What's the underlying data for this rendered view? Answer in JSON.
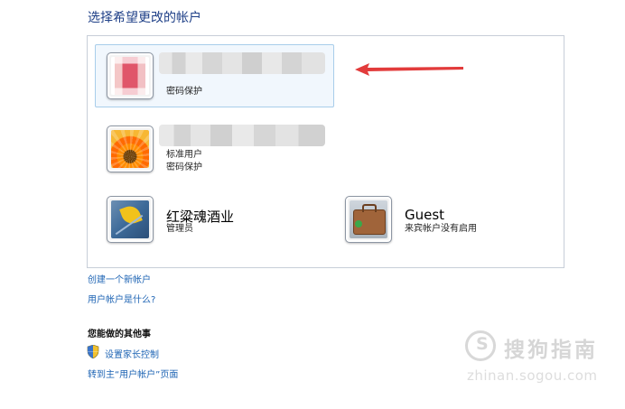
{
  "page": {
    "title": "选择希望更改的帐户"
  },
  "accounts": [
    {
      "name": "",
      "type": "",
      "password": "密码保护",
      "selected": true,
      "avatar": "blurred-avatar"
    },
    {
      "name": "",
      "type": "标准用户",
      "password": "密码保护",
      "selected": false,
      "avatar": "flower-avatar"
    },
    {
      "name": "红粱魂酒业",
      "type": "管理员",
      "password": "",
      "selected": false,
      "avatar": "leaf-avatar"
    },
    {
      "name": "Guest",
      "type": "来宾帐户没有启用",
      "password": "",
      "selected": false,
      "avatar": "suitcase-avatar"
    }
  ],
  "links": {
    "create_account": "创建一个新帐户",
    "what_is_account": "用户帐户是什么?"
  },
  "other": {
    "heading": "您能做的其他事",
    "parental_control": "设置家长控制",
    "goto_main": "转到主“用户帐户”页面"
  },
  "watermark": {
    "brand": "搜狗指南",
    "url": "zhinan.sogou.com"
  },
  "colors": {
    "link": "#1e64b4",
    "title": "#1e3f87",
    "selection_border": "#a8cdea",
    "arrow": "#e23b3b"
  },
  "icons": {
    "arrow": "red-arrow-icon",
    "shield": "uac-shield-icon"
  }
}
